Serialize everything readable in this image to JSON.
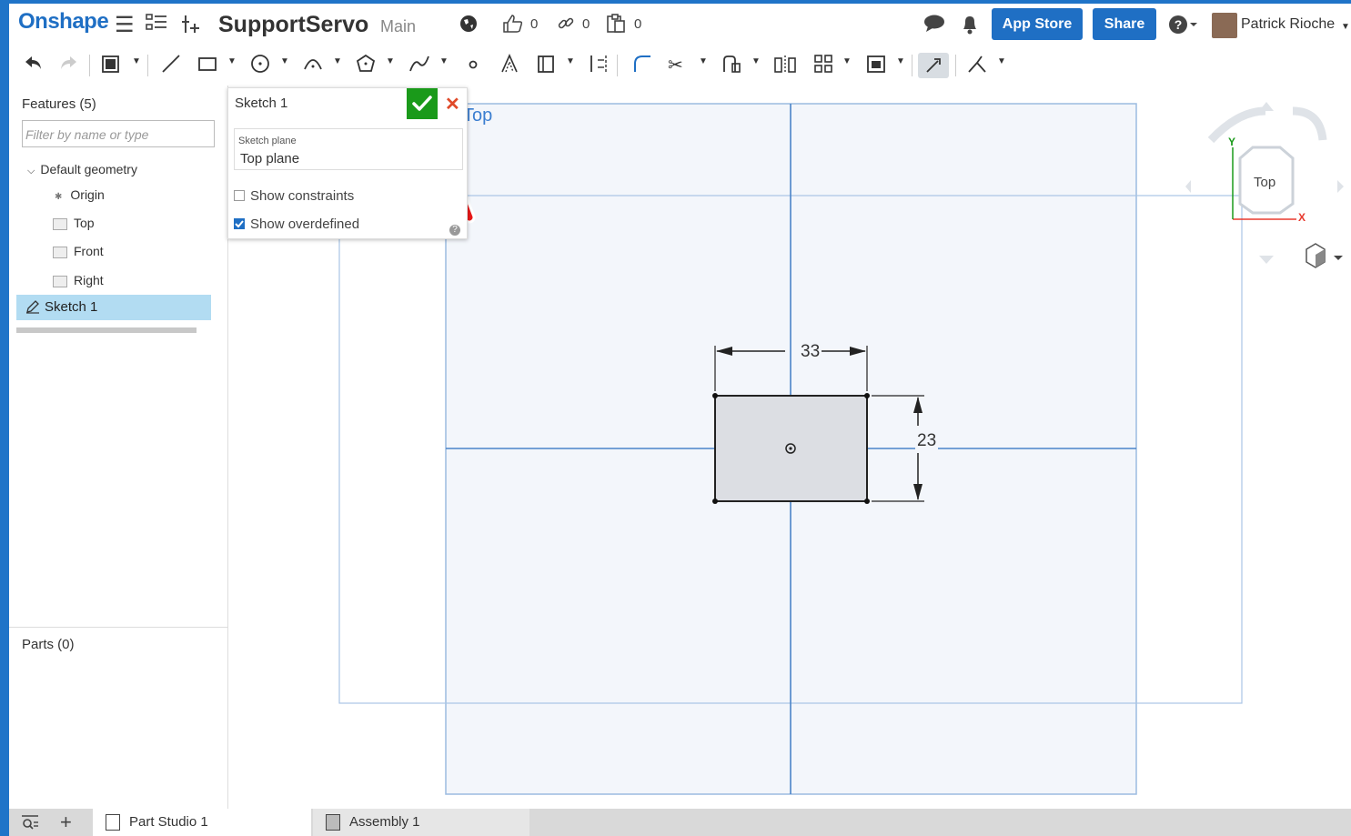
{
  "topbar": {
    "logo": "Onshape",
    "document_title": "SupportServo",
    "branch": "Main",
    "likes_count": "0",
    "links_count": "0",
    "versions_count": "0",
    "app_store_label": "App Store",
    "share_label": "Share",
    "user_name": "Patrick Rioche",
    "icons": [
      "menu-icon",
      "feature-list-icon",
      "insert-icon",
      "globe-icon",
      "like-icon",
      "link-icon",
      "clipboard-icon",
      "comment-icon",
      "bell-icon",
      "help-icon"
    ]
  },
  "toolbar": {
    "tools": [
      "undo",
      "redo",
      "sketch-mode",
      "line",
      "rectangle",
      "circle",
      "arc",
      "polygon",
      "spline",
      "point",
      "construction",
      "use",
      "offset",
      "fillet",
      "trim",
      "extend",
      "mirror",
      "pattern",
      "import",
      "dimension-mode",
      "constraints"
    ]
  },
  "features_panel": {
    "title": "Features (5)",
    "filter_placeholder": "Filter by name or type",
    "group_label": "Default geometry",
    "items": [
      {
        "label": "Origin"
      },
      {
        "label": "Top"
      },
      {
        "label": "Front"
      },
      {
        "label": "Right"
      }
    ],
    "sketch_item": "Sketch 1",
    "parts_title": "Parts (0)"
  },
  "sketch_dialog": {
    "title": "Sketch 1",
    "plane_label": "Sketch plane",
    "plane_value": "Top plane",
    "show_constraints_label": "Show constraints",
    "show_constraints_checked": false,
    "show_overdefined_label": "Show overdefined",
    "show_overdefined_checked": true,
    "help_glyph": "?"
  },
  "viewport": {
    "plane_name": "Top",
    "dimension_width": "33",
    "dimension_height": "23",
    "view_cube_label": "Top",
    "axis_x": "X",
    "axis_y": "Y"
  },
  "bottombar": {
    "tabs": [
      {
        "label": "Part Studio 1"
      },
      {
        "label": "Assembly 1"
      }
    ]
  },
  "colors": {
    "brand_blue": "#1f6fc4",
    "ok_green": "#1a9a1a",
    "cancel_red": "#e04a2a",
    "plane_blue": "#3b7ed0",
    "selection": "#b2dcf2"
  }
}
